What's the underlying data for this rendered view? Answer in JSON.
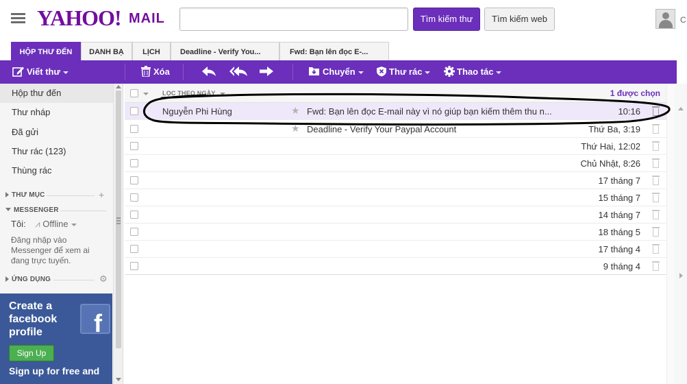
{
  "header": {
    "logo_text": "YAHOO!",
    "logo_suffix": "MAIL",
    "search_placeholder": "",
    "search_mail_label": "Tìm kiếm thư",
    "search_web_label": "Tìm kiếm web",
    "user_initial": "C"
  },
  "tabs": [
    {
      "label": "HỘP THƯ ĐẾN",
      "active": true
    },
    {
      "label": "DANH BẠ"
    },
    {
      "label": "LỊCH"
    },
    {
      "label": "Deadline - Verify You..."
    },
    {
      "label": "Fwd: Bạn lên đọc E-..."
    }
  ],
  "toolbar": {
    "compose": "Viết thư",
    "delete": "Xóa",
    "move": "Chuyển",
    "spam": "Thư rác",
    "actions": "Thao tác"
  },
  "sidebar": {
    "folders": [
      {
        "label": "Hộp thư đến",
        "active": true
      },
      {
        "label": "Thư nháp"
      },
      {
        "label": "Đã gửi"
      },
      {
        "label": "Thư rác (123)"
      },
      {
        "label": "Thùng rác"
      }
    ],
    "section_folders": "THƯ MỤC",
    "section_messenger": "MESSENGER",
    "messenger_me": "Tôi:",
    "messenger_status": "Offline",
    "messenger_note": "Đăng nhập vào Messenger để xem ai đang trực tuyến.",
    "section_apps": "ỨNG DỤNG"
  },
  "fb_ad": {
    "title": "Create a facebook profile",
    "button": "Sign Up",
    "subtitle": "Sign up for free and"
  },
  "list": {
    "sort_label": "LỌC THEO NGÀY",
    "selected_count": "1 được chọn",
    "rows": [
      {
        "sender": "Nguyễn Phi Hùng",
        "subject": "Fwd: Bạn lên đọc E-mail này vì nó giúp bạn kiếm thêm thu n...",
        "date": "10:16",
        "selected": true
      },
      {
        "sender": "",
        "subject": "Deadline - Verify Your Paypal Account",
        "date": "Thứ Ba, 3:19"
      },
      {
        "sender": "",
        "subject": "",
        "date": "Thứ Hai, 12:02"
      },
      {
        "sender": "",
        "subject": "",
        "date": "Chủ Nhật, 8:26"
      },
      {
        "sender": "",
        "subject": "",
        "date": "17 tháng 7"
      },
      {
        "sender": "",
        "subject": "",
        "date": "15 tháng 7"
      },
      {
        "sender": "",
        "subject": "",
        "date": "14 tháng 7"
      },
      {
        "sender": "",
        "subject": "",
        "date": "18 tháng 5"
      },
      {
        "sender": "",
        "subject": "",
        "date": "17 tháng 4"
      },
      {
        "sender": "",
        "subject": "",
        "date": "9 tháng 4"
      }
    ]
  },
  "colors": {
    "brand_purple": "#6b2fbb",
    "logo_purple": "#720e9e",
    "facebook_blue": "#3b5998",
    "selected_row": "#efe8fa"
  }
}
